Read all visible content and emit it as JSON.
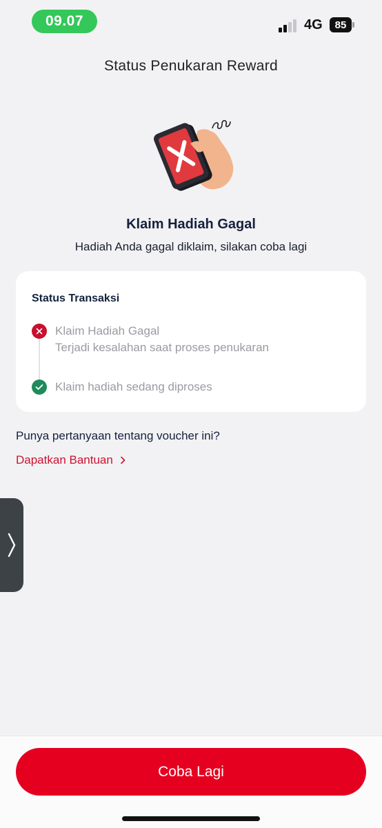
{
  "status_bar": {
    "time": "09.07",
    "network": "4G",
    "battery": "85"
  },
  "header": {
    "title": "Status Penukaran Reward"
  },
  "result": {
    "title": "Klaim Hadiah Gagal",
    "subtitle": "Hadiah Anda gagal diklaim, silakan coba lagi"
  },
  "transaction": {
    "title": "Status Transaksi",
    "steps": [
      {
        "status": "failed",
        "icon": "close-icon",
        "title": "Klaim Hadiah Gagal",
        "description": "Terjadi kesalahan saat proses penukaran"
      },
      {
        "status": "success",
        "icon": "check-icon",
        "title": "Klaim hadiah sedang diproses"
      }
    ]
  },
  "help": {
    "question": "Punya pertanyaan tentang voucher ini?",
    "link_label": "Dapatkan Bantuan"
  },
  "footer": {
    "button_label": "Coba Lagi"
  },
  "colors": {
    "accent_red": "#e60020",
    "success_green": "#1f8a5b",
    "status_pill_green": "#34c759"
  }
}
